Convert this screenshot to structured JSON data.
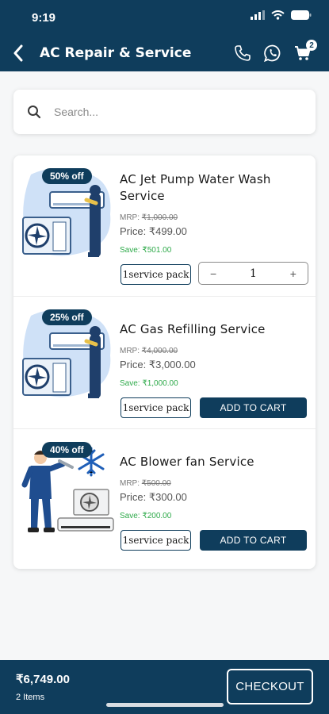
{
  "status_bar": {
    "time": "9:19"
  },
  "header": {
    "title": "AC Repair & Service",
    "back_icon": "chevron-left-icon",
    "call_icon": "phone-icon",
    "whatsapp_icon": "whatsapp-icon",
    "cart_icon": "cart-icon",
    "cart_count": "2"
  },
  "search": {
    "placeholder": "Search..."
  },
  "colors": {
    "primary": "#0f3d5c",
    "save_green": "#2eaa4a"
  },
  "services": [
    {
      "discount": "50% off",
      "title": "AC Jet Pump Water Wash Service",
      "mrp_label": "MRP:",
      "mrp": "₹1,000.00",
      "price": "Price: ₹499.00",
      "save": "Save: ₹501.00",
      "pack": "1service pack",
      "in_cart": true,
      "quantity": "1",
      "minus": "−",
      "plus": "+"
    },
    {
      "discount": "25% off",
      "title": "AC Gas Refilling Service",
      "mrp_label": "MRP:",
      "mrp": "₹4,000.00",
      "price": "Price: ₹3,000.00",
      "save": "Save: ₹1,000.00",
      "pack": "1service pack",
      "in_cart": false,
      "action": "ADD TO CART"
    },
    {
      "discount": "40% off",
      "title": "AC Blower fan Service",
      "mrp_label": "MRP:",
      "mrp": "₹500.00",
      "price": "Price: ₹300.00",
      "save": "Save: ₹200.00",
      "pack": "1service pack",
      "in_cart": false,
      "action": "ADD TO CART"
    }
  ],
  "footer": {
    "total": "₹6,749.00",
    "items": "2 Items",
    "checkout": "CHECKOUT"
  }
}
